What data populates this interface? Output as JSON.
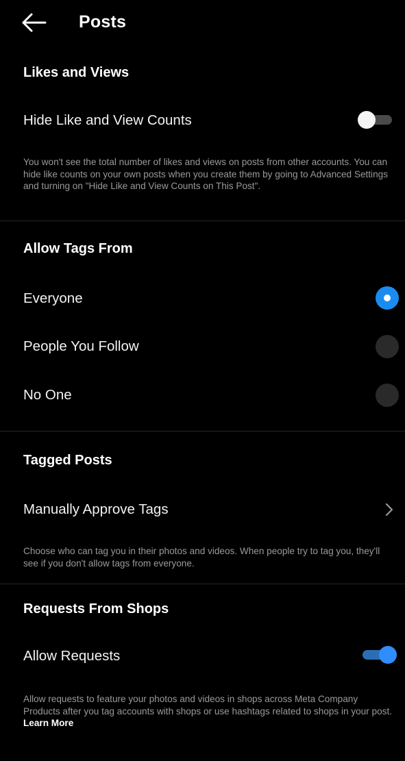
{
  "header": {
    "title": "Posts",
    "back_icon": "arrow-left-icon"
  },
  "likes_views": {
    "section_title": "Likes and Views",
    "toggle_label": "Hide Like and View Counts",
    "toggle_on": false,
    "description": "You won't see the total number of likes and views on posts from other accounts. You can hide like counts on your own posts when you create them by going to Advanced Settings and turning on \"Hide Like and View Counts on This Post\"."
  },
  "allow_tags": {
    "section_title": "Allow Tags From",
    "options": [
      {
        "label": "Everyone",
        "selected": true
      },
      {
        "label": "People You Follow",
        "selected": false
      },
      {
        "label": "No One",
        "selected": false
      }
    ]
  },
  "tagged_posts": {
    "section_title": "Tagged Posts",
    "row_label": "Manually Approve Tags",
    "row_icon": "chevron-right-icon",
    "description": "Choose who can tag you in their photos and videos. When people try to tag you, they'll see if you don't allow tags from everyone."
  },
  "shop_requests": {
    "section_title": "Requests From Shops",
    "toggle_label": "Allow Requests",
    "toggle_on": true,
    "description": "Allow requests to feature your photos and videos in shops across Meta Company Products after you tag accounts with shops or use hashtags related to shops in your post.",
    "learn_more": "Learn More"
  },
  "colors": {
    "background": "#000000",
    "accent": "#1a8cf0",
    "secondary_text": "#9a9a9a",
    "divider": "#262626"
  }
}
